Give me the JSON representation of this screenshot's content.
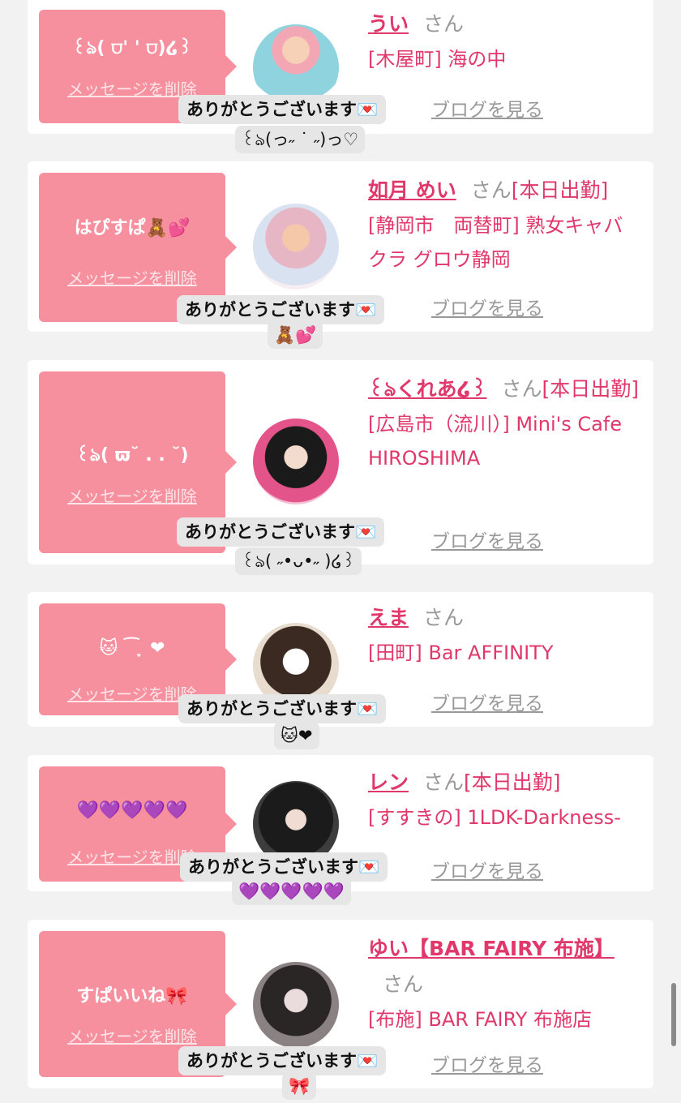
{
  "common": {
    "delete_label": "メッセージを削除",
    "blog_label": "ブログを見る",
    "thanks_label": "ありがとうございます💌",
    "san_label": "さん"
  },
  "cards": [
    {
      "bubble_text": "꒰ঌ( ⩌' ' ⩌)໒꒱",
      "name": "うい",
      "status": "",
      "shop": "[木屋町] 海の中",
      "reply": "꒰ঌ(っ˶ ˙ ˶)っ♡"
    },
    {
      "bubble_text": "はぴすぱ🧸💕",
      "name": "如月 めい",
      "status": "[本日出勤]",
      "shop": "[静岡市　両替町] 熟女キャバクラ グロウ静岡",
      "reply": "🧸💕"
    },
    {
      "bubble_text": "꒰ঌ( ϖ˘ . . ˘)",
      "name": "꒰ঌくれあ໒꒱",
      "status": "[本日出勤]",
      "shop": "[広島市（流川）] Mini's Cafe HIROSHIMA",
      "reply": "꒰ঌ( ˶•ᴗ•˶ )໒꒱"
    },
    {
      "bubble_text": "🐱︎ ⁀ ֶָ֢ ❤︎",
      "name": "えま",
      "status": "",
      "shop": "[田町] Bar AFFINITY",
      "reply": "🐱︎❤︎"
    },
    {
      "bubble_text": "💜💜💜💜💜",
      "name": "レン",
      "status": "[本日出勤]",
      "shop": "[すすきの] 1LDK-Darkness-",
      "reply": "💜💜💜💜💜"
    },
    {
      "bubble_text": "すぱいいね🎀",
      "name": "ゆい【BAR FAIRY 布施】",
      "status": "",
      "shop": "[布施] BAR FAIRY 布施店",
      "reply": "🎀"
    }
  ],
  "colors": {
    "accent": "#e0386a",
    "bubble": "#f7909e",
    "background": "#f2f2f2"
  }
}
